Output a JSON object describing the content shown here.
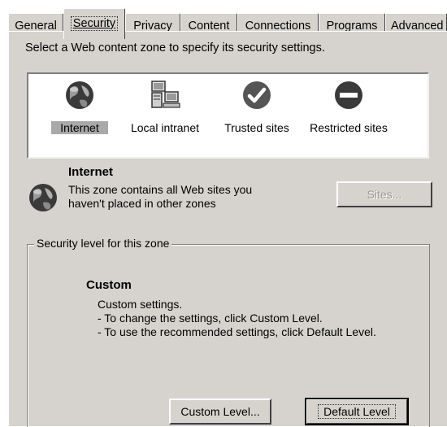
{
  "tabs": [
    {
      "label": "General"
    },
    {
      "label": "Security"
    },
    {
      "label": "Privacy"
    },
    {
      "label": "Content"
    },
    {
      "label": "Connections"
    },
    {
      "label": "Programs"
    },
    {
      "label": "Advanced"
    }
  ],
  "instruction": "Select a Web content zone to specify its security settings.",
  "zones": [
    {
      "label": "Internet",
      "icon": "globe-icon",
      "selected": true
    },
    {
      "label": "Local intranet",
      "icon": "computer-network-icon"
    },
    {
      "label": "Trusted sites",
      "icon": "checkmark-icon"
    },
    {
      "label": "Restricted sites",
      "icon": "no-entry-icon"
    }
  ],
  "info": {
    "title": "Internet",
    "description_line1": "This zone contains all Web sites you",
    "description_line2": "haven't placed in other zones",
    "sites_button": "Sites..."
  },
  "security_level": {
    "group_label": "Security level for this zone",
    "level_name": "Custom",
    "desc_line1": "Custom settings.",
    "desc_line2": "- To change the settings, click Custom Level.",
    "desc_line3": "- To use the recommended settings, click Default Level.",
    "custom_button": "Custom Level...",
    "default_button": "Default Level"
  },
  "colors": {
    "dialog_face": "#d6d3ce",
    "selection": "#a9a9a9"
  }
}
